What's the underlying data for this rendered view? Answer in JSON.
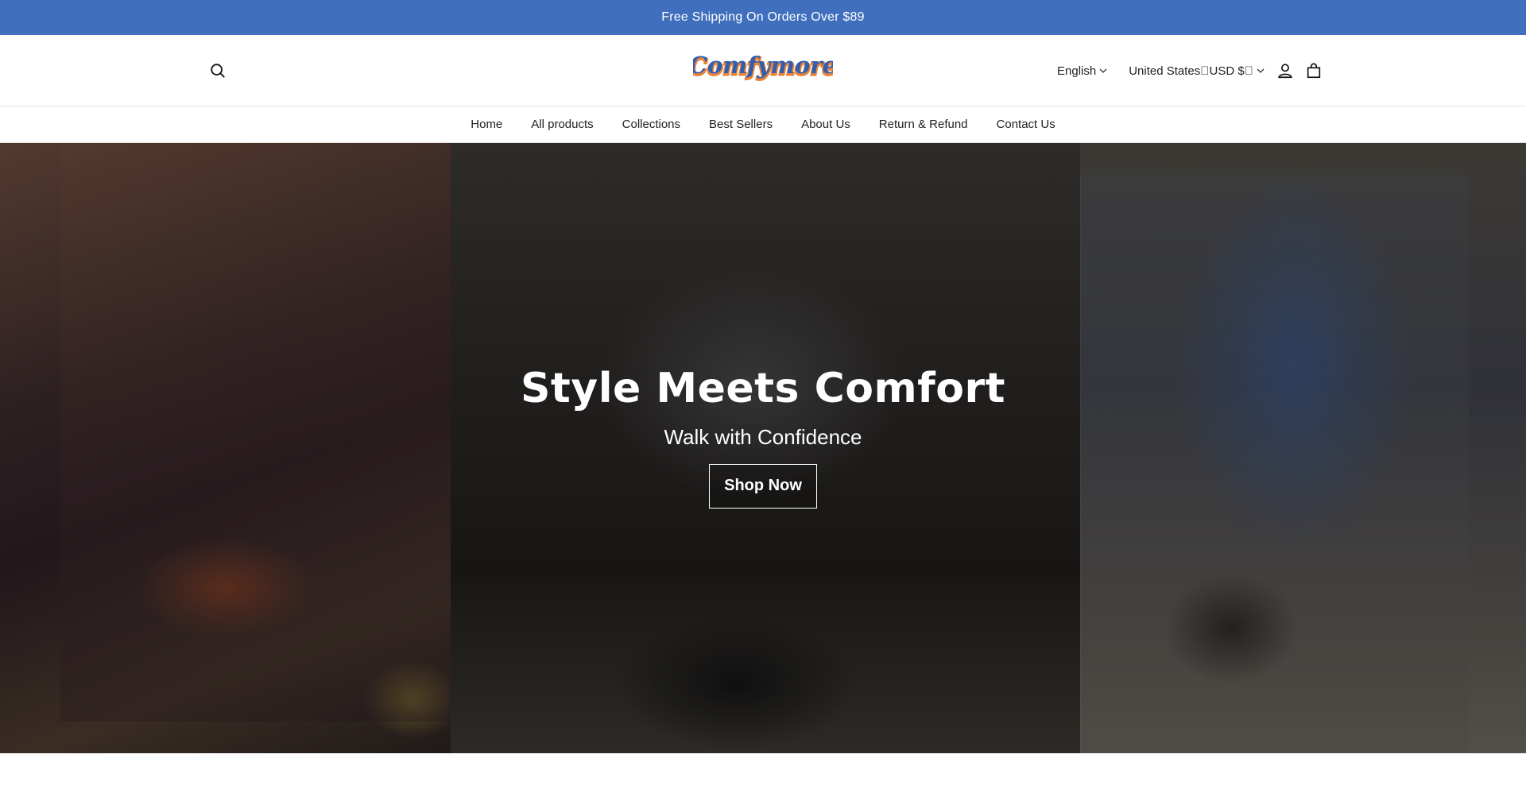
{
  "announcement": {
    "text": "Free Shipping On Orders Over $89"
  },
  "header": {
    "logo_text": "Comfymore",
    "language": "English",
    "currency": "United States\u0000USD $\u0000"
  },
  "nav": {
    "items": [
      {
        "label": "Home"
      },
      {
        "label": "All products"
      },
      {
        "label": "Collections"
      },
      {
        "label": "Best Sellers"
      },
      {
        "label": "About Us"
      },
      {
        "label": "Return & Refund"
      },
      {
        "label": "Contact Us"
      }
    ]
  },
  "hero": {
    "title": "Style Meets Comfort",
    "subtitle": "Walk with Confidence",
    "cta": "Shop Now"
  },
  "colors": {
    "announcement_bg": "#3f6fbd",
    "logo_blue": "#2f5fb3",
    "logo_orange": "#e8843a"
  }
}
